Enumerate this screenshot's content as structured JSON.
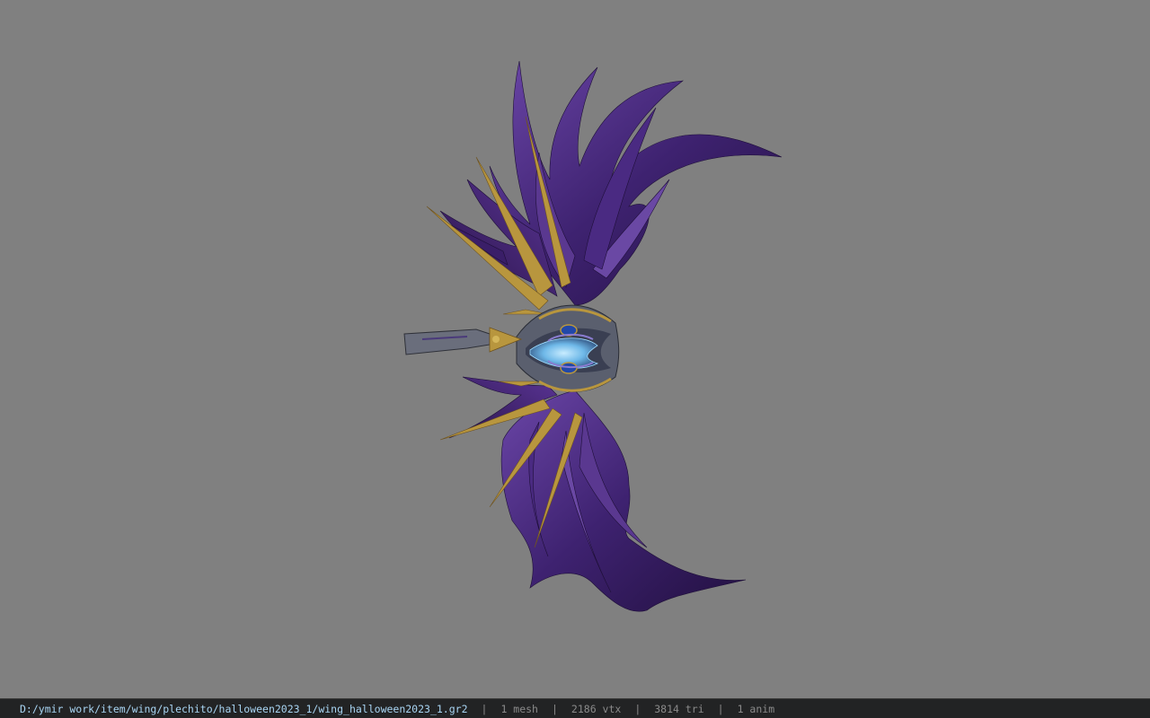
{
  "viewport": {
    "background_color": "#808080",
    "model": {
      "name": "wing_halloween2023_1",
      "colors": {
        "feather_dark": "#2a1548",
        "feather_mid": "#4a2a82",
        "feather_light": "#7a56b8",
        "gold": "#b8963e",
        "crystal": "#7ec8f0",
        "metal": "#5a5f6e"
      }
    }
  },
  "status_bar": {
    "file_path": "D:/ymir work/item/wing/plechito/halloween2023_1/wing_halloween2023_1.gr2",
    "separator": "|",
    "mesh_count": "1 mesh",
    "vertex_count": "2186 vtx",
    "triangle_count": "3814 tri",
    "anim_count": "1 anim",
    "path_color": "#a8d4f2",
    "stat_color": "#8a8a8a"
  }
}
